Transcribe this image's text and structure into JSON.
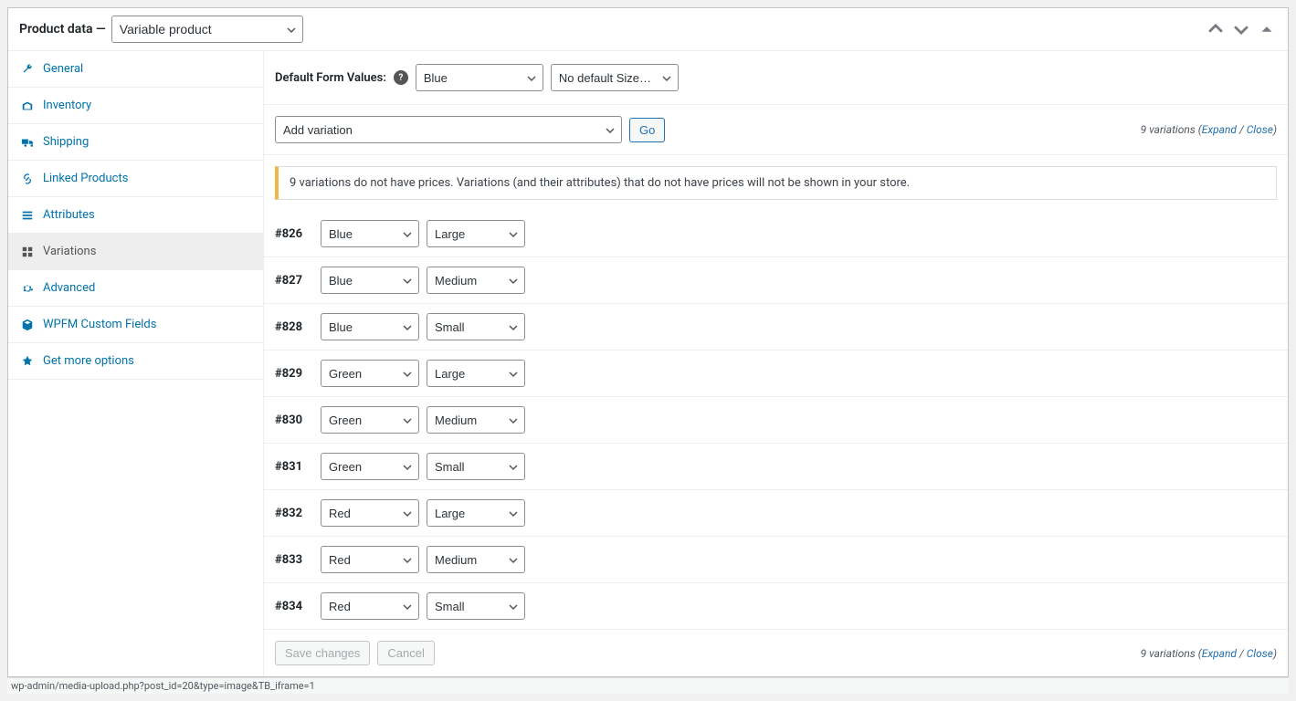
{
  "header": {
    "title": "Product data —",
    "product_type": "Variable product"
  },
  "sidebar": {
    "items": [
      {
        "label": "General",
        "icon": "wrench-icon"
      },
      {
        "label": "Inventory",
        "icon": "inventory-icon"
      },
      {
        "label": "Shipping",
        "icon": "truck-icon"
      },
      {
        "label": "Linked Products",
        "icon": "link-icon"
      },
      {
        "label": "Attributes",
        "icon": "list-icon"
      },
      {
        "label": "Variations",
        "icon": "grid-icon",
        "active": true
      },
      {
        "label": "Advanced",
        "icon": "gear-icon"
      },
      {
        "label": "WPFM Custom Fields",
        "icon": "cube-icon"
      },
      {
        "label": "Get more options",
        "icon": "more-icon"
      }
    ]
  },
  "default_form_values": {
    "label": "Default Form Values:",
    "color": "Blue",
    "size": "No default Size…"
  },
  "toolbar": {
    "add_variation": "Add variation",
    "go": "Go",
    "count_text": "9 variations",
    "expand": "Expand",
    "close": "Close"
  },
  "notice": "9 variations do not have prices. Variations (and their attributes) that do not have prices will not be shown in your store.",
  "variations": [
    {
      "id": "#826",
      "color": "Blue",
      "size": "Large"
    },
    {
      "id": "#827",
      "color": "Blue",
      "size": "Medium"
    },
    {
      "id": "#828",
      "color": "Blue",
      "size": "Small"
    },
    {
      "id": "#829",
      "color": "Green",
      "size": "Large"
    },
    {
      "id": "#830",
      "color": "Green",
      "size": "Medium"
    },
    {
      "id": "#831",
      "color": "Green",
      "size": "Small"
    },
    {
      "id": "#832",
      "color": "Red",
      "size": "Large"
    },
    {
      "id": "#833",
      "color": "Red",
      "size": "Medium"
    },
    {
      "id": "#834",
      "color": "Red",
      "size": "Small"
    }
  ],
  "footer": {
    "save": "Save changes",
    "cancel": "Cancel",
    "count_text": "9 variations",
    "expand": "Expand",
    "close": "Close"
  },
  "status_line": "wp-admin/media-upload.php?post_id=20&type=image&TB_iframe=1"
}
